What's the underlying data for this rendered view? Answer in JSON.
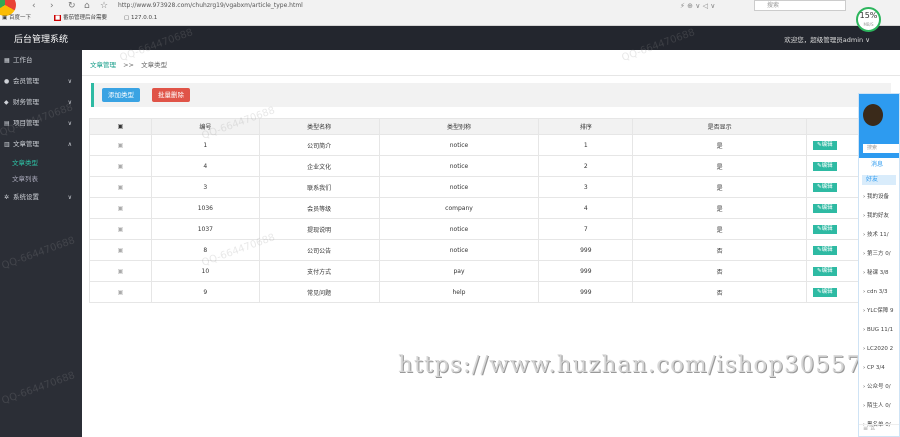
{
  "browser": {
    "url": "http://www.973928.com/chuhzrg19/vgabxm/article_type.html",
    "bookmarks": [
      "百度一下",
      "番茄管理后台需要",
      "127.0.0.1"
    ],
    "search_placeholder": "搜索",
    "speed_value": "15%",
    "speed_unit": "MB/S"
  },
  "app": {
    "title": "后台管理系统",
    "welcome": "欢迎您，超级管理员admin ∨"
  },
  "sidebar": {
    "items": [
      {
        "label": "工作台",
        "icon": "dashboard-icon",
        "expandable": false
      },
      {
        "label": "会员管理",
        "icon": "member-icon",
        "expandable": true
      },
      {
        "label": "财务管理",
        "icon": "finance-icon",
        "expandable": true
      },
      {
        "label": "项目管理",
        "icon": "project-icon",
        "expandable": true
      },
      {
        "label": "文章管理",
        "icon": "article-icon",
        "expandable": true,
        "expanded": true
      }
    ],
    "sub_items": [
      "文章类型",
      "文章列表"
    ],
    "last_item": {
      "label": "系统设置",
      "icon": "settings-icon"
    }
  },
  "breadcrumb": {
    "root": "文章管理",
    "sep": ">>",
    "current": "文章类型"
  },
  "toolbar": {
    "add_label": "添加类型",
    "delete_label": "批量删除"
  },
  "table": {
    "headers": [
      "",
      "编号",
      "类型名称",
      "类型别称",
      "排序",
      "是否显示",
      ""
    ],
    "rows": [
      {
        "id": "1",
        "name": "公司简介",
        "alias": "notice",
        "sort": "1",
        "show": "是"
      },
      {
        "id": "4",
        "name": "企业文化",
        "alias": "notice",
        "sort": "2",
        "show": "是"
      },
      {
        "id": "3",
        "name": "联系我们",
        "alias": "notice",
        "sort": "3",
        "show": "是"
      },
      {
        "id": "1036",
        "name": "会员等级",
        "alias": "company",
        "sort": "4",
        "show": "是"
      },
      {
        "id": "1037",
        "name": "提现说明",
        "alias": "notice",
        "sort": "7",
        "show": "是"
      },
      {
        "id": "8",
        "name": "公司公告",
        "alias": "notice",
        "sort": "999",
        "show": "否"
      },
      {
        "id": "10",
        "name": "支付方式",
        "alias": "pay",
        "sort": "999",
        "show": "否"
      },
      {
        "id": "9",
        "name": "常见问题",
        "alias": "help",
        "sort": "999",
        "show": "否"
      }
    ],
    "edit_label": "编辑"
  },
  "watermarks": {
    "qq": "QQ-664470688",
    "site": "https://www.huzhan.com/ishop30557"
  },
  "qq_panel": {
    "search": "搜索",
    "tab": "消息",
    "friend": "好友",
    "groups": [
      "我的设备",
      "我的好友",
      "技术 11/",
      "第三方 0/",
      "秘课 3/8",
      "cdn 3/3",
      "YLC保障 9",
      "BUG 11/1",
      "LC2020 2",
      "CP 3/4",
      "公众号 0/",
      "陌生人 0/",
      "黑名单 0/"
    ]
  },
  "colors": {
    "accent": "#2ebaa3",
    "topbar": "#23262e",
    "sidebar": "#2b2e36",
    "add_btn": "#3aa3e3",
    "delete_btn": "#e05448"
  }
}
